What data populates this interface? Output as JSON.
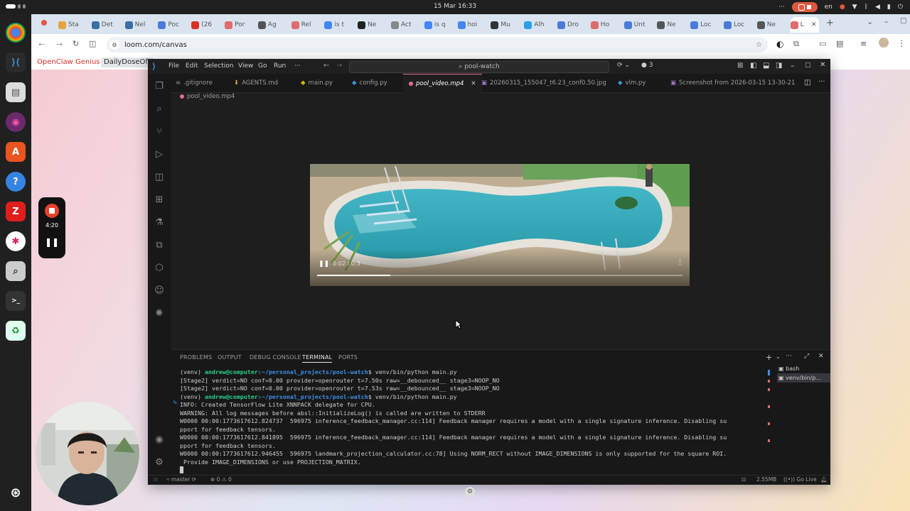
{
  "system": {
    "datetime": "15 Mar  16:33",
    "language": "en"
  },
  "chrome": {
    "tabs": [
      "Sta",
      "Det",
      "Nel",
      "Poc",
      "(26",
      "Por",
      "Ag",
      "Rel",
      "is t",
      "Ne",
      "Act",
      "is q",
      "hoi",
      "Mu",
      "Alh",
      "Dro",
      "Ho",
      "Unt",
      "Ne",
      "Loc",
      "Loc",
      "Ne",
      "L"
    ],
    "url": "loom.com/canvas",
    "bookmarks": [
      "OpenClaw Genius",
      "DailyDoseOfL"
    ]
  },
  "vscode": {
    "menu": [
      "File",
      "Edit",
      "Selection",
      "View",
      "Go",
      "Run",
      "···"
    ],
    "command_center": "pool-watch",
    "badge": "3",
    "editor_tabs": [
      ".gitignore",
      "AGENTS.md",
      "main.py",
      "config.py",
      "pool_video.mp4",
      "20260315_155047_t6.23_conf0.50.jpg",
      "vlm.py",
      "Screenshot from 2026-03-15 13-30-21"
    ],
    "breadcrumb": "pool_video.mp4",
    "video": {
      "time": "0:02 / 0:3",
      "progress": 0.2
    },
    "panel_tabs": [
      "PROBLEMS",
      "OUTPUT",
      "DEBUG CONSOLE",
      "TERMINAL",
      "PORTS"
    ],
    "terminal": {
      "lines": [
        {
          "prefix": "(venv) ",
          "user": "andrew@computer",
          "path": ":~/personal_projects/pool-watch",
          "cmd": "$ venv/bin/python main.py"
        },
        {
          "text": "[Stage2] verdict=NO conf=0.00 provider=openrouter t=7.50s raw=__debounced__ stage3=NOOP_NO"
        },
        {
          "text": "[Stage2] verdict=NO conf=0.00 provider=openrouter t=7.53s raw=__debounced__ stage3=NOOP_NO"
        },
        {
          "prefix": "(venv) ",
          "user": "andrew@computer",
          "path": ":~/personal_projects/pool-watch",
          "cmd": "$ venv/bin/python main.py"
        },
        {
          "text": "INFO: Created TensorFlow Lite XNNPACK delegate for CPU."
        },
        {
          "text": "WARNING: All log messages before absl::InitializeLog() is called are written to STDERR"
        },
        {
          "text": "W0000 00:00:1773617612.824737  596975 inference_feedback_manager.cc:114] Feedback manager requires a model with a single signature inference. Disabling su"
        },
        {
          "text": "pport for feedback tensors."
        },
        {
          "text": "W0000 00:00:1773617612.841895  596975 inference_feedback_manager.cc:114] Feedback manager requires a model with a single signature inference. Disabling su"
        },
        {
          "text": "pport for feedback tensors."
        },
        {
          "text": "W0000 00:00:1773617612.946455  596975 landmark_projection_calculator.cc:78] Using NORM_RECT without IMAGE_DIMENSIONS is only supported for the square ROI."
        },
        {
          "text": " Provide IMAGE_DIMENSIONS or use PROJECTION_MATRIX."
        },
        {
          "text": "█"
        }
      ],
      "instances": [
        "bash",
        "venv/bin/p..."
      ]
    },
    "status": {
      "branch": "master",
      "problems": "0",
      "warnings": "0",
      "memory": "2.55MB",
      "golive": "Go Live"
    }
  },
  "loom": {
    "timer": "4:20"
  },
  "colors": {
    "vscode_bg": "#1e1e1e",
    "accent_pink": "#e06c9f",
    "terminal_green": "#23d18b",
    "terminal_blue": "#3b8eea",
    "loom_red": "#e8412c"
  }
}
